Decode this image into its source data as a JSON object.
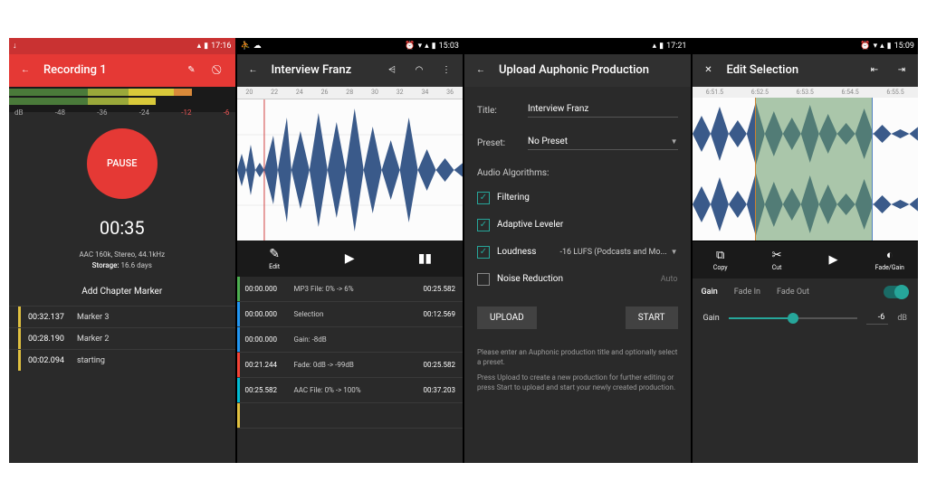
{
  "screen1": {
    "status_time": "17:16",
    "title": "Recording 1",
    "db_labels": [
      "dB",
      "-48",
      "-36",
      "-24",
      "-12",
      "-6"
    ],
    "pause_label": "PAUSE",
    "timer": "00:35",
    "codec_line": "AAC 160k, Stereo, 44.1kHz",
    "storage_label": "Storage:",
    "storage_value": "16.6 days",
    "chapter_header": "Add Chapter Marker",
    "markers": [
      {
        "time": "00:32.137",
        "label": "Marker 3"
      },
      {
        "time": "00:28.190",
        "label": "Marker 2"
      },
      {
        "time": "00:02.094",
        "label": "starting"
      }
    ]
  },
  "screen2": {
    "status_time": "15:03",
    "title": "Interview Franz",
    "ruler": [
      "20",
      "22",
      "24",
      "26",
      "28",
      "30",
      "32",
      "34",
      "36"
    ],
    "edit_label": "Edit",
    "regions": [
      {
        "accent": "ra-green",
        "start": "00:00.000",
        "desc": "MP3 File: 0% -> 6%",
        "end": "00:25.582"
      },
      {
        "accent": "ra-blue",
        "start": "00:00.000",
        "desc": "Selection",
        "end": "00:12.569"
      },
      {
        "accent": "ra-blue",
        "start": "00:00.000",
        "desc": "Gain: -8dB",
        "end": ""
      },
      {
        "accent": "ra-red",
        "start": "00:21.244",
        "desc": "Fade: 0dB -> -99dB",
        "end": "00:25.582"
      },
      {
        "accent": "ra-cyan",
        "start": "00:25.582",
        "desc": "AAC File: 0% -> 100%",
        "end": "00:37.203"
      },
      {
        "accent": "ra-yellow",
        "start": "",
        "desc": "",
        "end": ""
      }
    ]
  },
  "screen3": {
    "status_time": "17:21",
    "title": "Upload Auphonic Production",
    "title_label": "Title:",
    "title_value": "Interview Franz",
    "preset_label": "Preset:",
    "preset_value": "No Preset",
    "algorithms_label": "Audio Algorithms:",
    "filtering_label": "Filtering",
    "leveler_label": "Adaptive Leveler",
    "loudness_label": "Loudness",
    "loudness_value": "-16 LUFS (Podcasts and Mo...",
    "noise_label": "Noise Reduction",
    "noise_value": "Auto",
    "upload_btn": "UPLOAD",
    "start_btn": "START",
    "help1": "Please enter an Auphonic production title and optionally select a preset.",
    "help2": "Press Upload to create a new production for further editing or press Start to upload and start your newly created production."
  },
  "screen4": {
    "status_time": "15:09",
    "title": "Edit Selection",
    "ruler": [
      "6:51.5",
      "6:52.5",
      "6:53.5",
      "6:54.5",
      "6:55.5"
    ],
    "copy_label": "Copy",
    "cut_label": "Cut",
    "fadegain_label": "Fade/Gain",
    "tab_gain": "Gain",
    "tab_fadein": "Fade In",
    "tab_fadeout": "Fade Out",
    "gain_label": "Gain",
    "gain_value": "-6",
    "gain_unit": "dB"
  }
}
